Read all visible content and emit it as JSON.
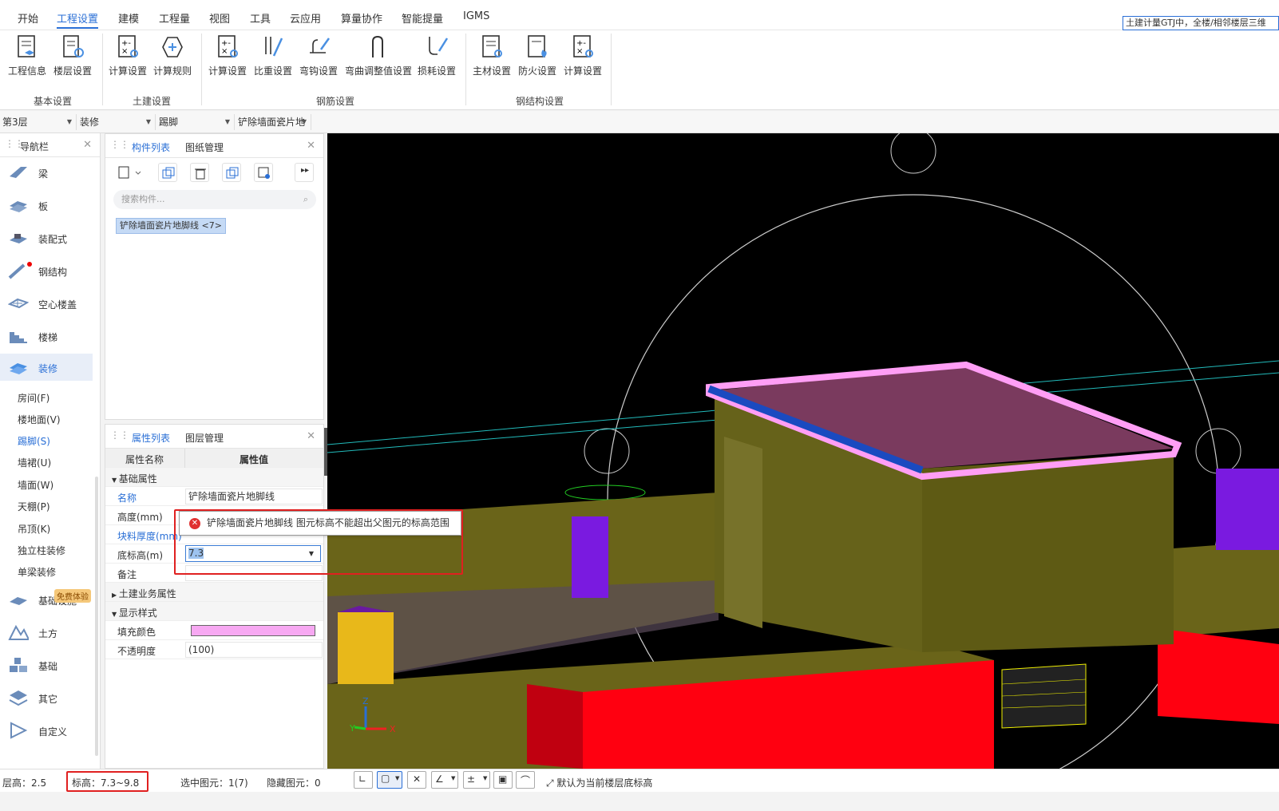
{
  "menu": {
    "items": [
      "开始",
      "工程设置",
      "建模",
      "工程量",
      "视图",
      "工具",
      "云应用",
      "算量协作",
      "智能提量",
      "IGMS"
    ],
    "active": "工程设置",
    "right_status": "土建计量GTJ中，全楼/相邻楼层三维"
  },
  "ribbon": {
    "groups": [
      {
        "label": "基本设置",
        "buttons": [
          "工程信息",
          "楼层设置"
        ]
      },
      {
        "label": "土建设置",
        "buttons": [
          "计算设置",
          "计算规则"
        ]
      },
      {
        "label": "钢筋设置",
        "buttons": [
          "计算设置",
          "比重设置",
          "弯钩设置",
          "弯曲调整值设置",
          "损耗设置"
        ]
      },
      {
        "label": "钢结构设置",
        "buttons": [
          "主材设置",
          "防火设置",
          "计算设置"
        ]
      }
    ]
  },
  "filters": {
    "floor": "第3层",
    "category": "装修",
    "type": "踢脚",
    "component": "铲除墙面瓷片地"
  },
  "nav": {
    "title": "导航栏",
    "items": [
      "梁",
      "板",
      "装配式",
      "钢结构",
      "空心楼盖",
      "楼梯",
      "装修"
    ],
    "selected": "装修",
    "sub_items": [
      "房间(F)",
      "楼地面(V)",
      "踢脚(S)",
      "墙裙(U)",
      "墙面(W)",
      "天棚(P)",
      "吊顶(K)",
      "独立柱装修",
      "单梁装修"
    ],
    "sub_selected": "踢脚(S)",
    "items2": [
      "基础设施",
      "土方",
      "基础",
      "其它",
      "自定义"
    ],
    "badge": "免费体验"
  },
  "components": {
    "tabs": [
      "构件列表",
      "图纸管理"
    ],
    "search_placeholder": "搜索构件...",
    "items": [
      "铲除墙面瓷片地脚线 <7>"
    ]
  },
  "properties": {
    "tabs": [
      "属性列表",
      "图层管理"
    ],
    "headers": [
      "属性名称",
      "属性值"
    ],
    "rows": [
      {
        "k": "基础属性",
        "v": "",
        "section": true
      },
      {
        "k": "名称",
        "v": "铲除墙面瓷片地脚线",
        "blue": true
      },
      {
        "k": "高度(mm)",
        "v": ""
      },
      {
        "k": "块料厚度(mm)",
        "v": "",
        "blue": true
      },
      {
        "k": "底标高(m)",
        "v": "7.3"
      },
      {
        "k": "备注",
        "v": ""
      },
      {
        "k": "土建业务属性",
        "v": "",
        "section": true,
        "collapsed": true
      },
      {
        "k": "显示样式",
        "v": "",
        "section": true
      },
      {
        "k": "填充颜色",
        "v": "",
        "color": "#f7a8f2"
      },
      {
        "k": "不透明度",
        "v": "(100)"
      }
    ]
  },
  "error": {
    "message": "铲除墙面瓷片地脚线 图元标高不能超出父图元的标高范围"
  },
  "viewport": {
    "axis": [
      "Z",
      "Y",
      "X"
    ]
  },
  "status": {
    "floor_height": "层高：2.5",
    "elevation": "标高：7.3~9.8",
    "selected": "选中图元：1(7)",
    "hidden": "隐藏图元：0",
    "hint": "默认为当前楼层底标高"
  }
}
